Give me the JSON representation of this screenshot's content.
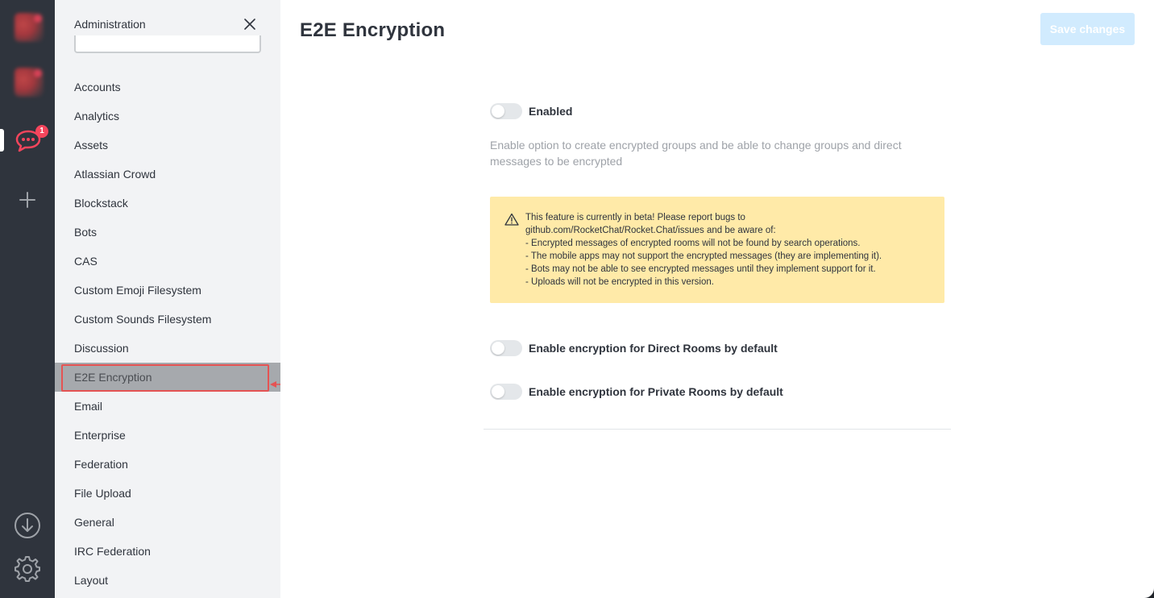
{
  "rail": {
    "badge_count": "1",
    "icons": [
      "chat-icon",
      "plus-icon",
      "download-icon",
      "gear-icon"
    ]
  },
  "sidebar": {
    "title": "Administration",
    "items": [
      {
        "label": "Accounts"
      },
      {
        "label": "Analytics"
      },
      {
        "label": "Assets"
      },
      {
        "label": "Atlassian Crowd"
      },
      {
        "label": "Blockstack"
      },
      {
        "label": "Bots"
      },
      {
        "label": "CAS"
      },
      {
        "label": "Custom Emoji Filesystem"
      },
      {
        "label": "Custom Sounds Filesystem"
      },
      {
        "label": "Discussion"
      },
      {
        "label": "E2E Encryption"
      },
      {
        "label": "Email"
      },
      {
        "label": "Enterprise"
      },
      {
        "label": "Federation"
      },
      {
        "label": "File Upload"
      },
      {
        "label": "General"
      },
      {
        "label": "IRC Federation"
      },
      {
        "label": "Layout"
      }
    ],
    "active_index": 10
  },
  "main": {
    "title": "E2E Encryption",
    "save_label": "Save changes",
    "enabled_label": "Enabled",
    "enabled_description": "Enable option to create encrypted groups and be able to change groups and direct messages to be encrypted",
    "warning_lines": [
      "This feature is currently in beta! Please report bugs to",
      "github.com/RocketChat/Rocket.Chat/issues and be aware of:",
      "- Encrypted messages of encrypted rooms will not be found by search operations.",
      "- The mobile apps may not support the encrypted messages (they are implementing it).",
      "- Bots may not be able to see encrypted messages until they implement support for it.",
      "- Uploads will not be encrypted in this version."
    ],
    "direct_rooms_label": "Enable encryption for Direct Rooms by default",
    "private_rooms_label": "Enable encryption for Private Rooms by default"
  },
  "colors": {
    "accent": "#1d74f5",
    "badge": "#f5455c",
    "warning_bg": "#ffeaa8",
    "highlight": "#e55353"
  }
}
